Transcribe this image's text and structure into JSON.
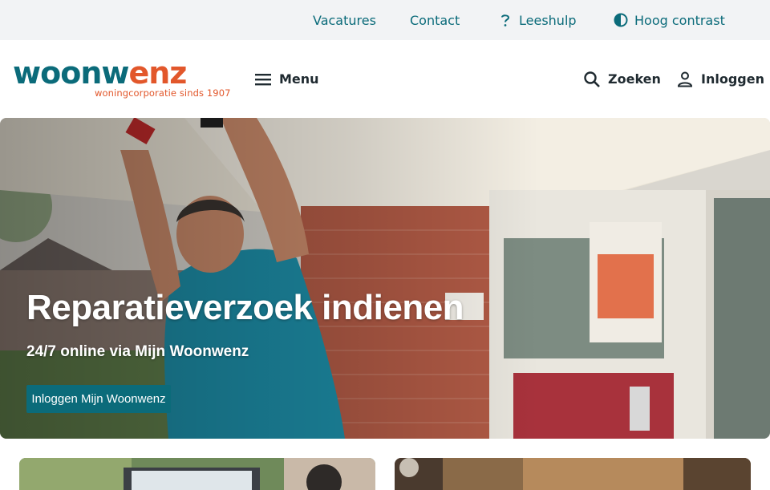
{
  "utility_nav": {
    "vacatures": "Vacatures",
    "contact": "Contact",
    "leeshulp": "Leeshulp",
    "hoog_contrast": "Hoog contrast"
  },
  "brand": {
    "logo_part1": "woonw",
    "logo_part2": "enz",
    "tagline": "woningcorporatie sinds 1907",
    "primary_color": "#0b6b7a",
    "accent_color": "#e2572b"
  },
  "header": {
    "menu_label": "Menu",
    "search_label": "Zoeken",
    "login_label": "Inloggen"
  },
  "icons": {
    "menu": "hamburger-icon",
    "search": "magnifier-icon",
    "login": "user-icon",
    "leeshulp": "question-mark-icon",
    "contrast": "half-circle-icon"
  },
  "hero": {
    "title": "Reparatieverzoek indienen",
    "subtitle": "24/7 online via Mijn Woonwenz",
    "cta_label": "Inloggen Mijn Woonwenz"
  }
}
